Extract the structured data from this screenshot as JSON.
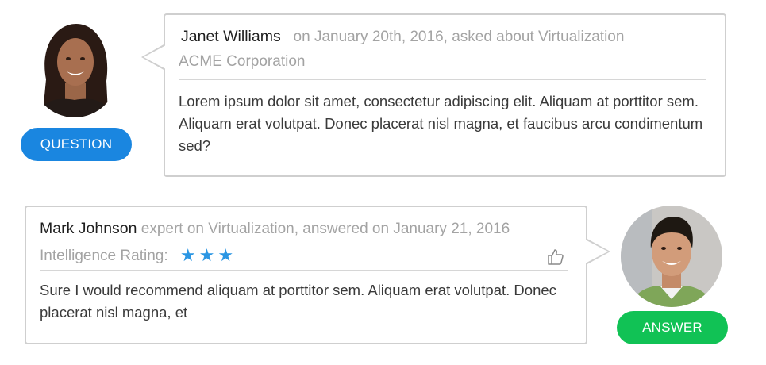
{
  "question": {
    "author": "Janet Williams",
    "meta": "on January 20th, 2016, asked about Virtualization",
    "company": "ACME Corporation",
    "body": "Lorem ipsum dolor sit amet, consectetur adipiscing elit. Aliquam at porttitor sem. Aliquam erat volutpat. Donec placerat nisl magna, et faucibus arcu condimentum sed?",
    "badge_label": "QUESTION",
    "badge_color": "#1a86e0"
  },
  "answer": {
    "author": "Mark Johnson",
    "meta": "expert on Virtualization, answered on January 21, 2016",
    "rating_label": "Intelligence Rating:",
    "rating_stars": 3,
    "rating_glyph": "★",
    "body": "Sure I would recommend aliquam at porttitor sem. Aliquam erat volutpat. Donec placerat nisl magna, et",
    "badge_label": "ANSWER",
    "badge_color": "#11c255",
    "like_icon": "thumbs-up-icon"
  },
  "colors": {
    "border": "#cfcfcf",
    "muted_text": "#a3a3a3",
    "star": "#2b96e3"
  }
}
